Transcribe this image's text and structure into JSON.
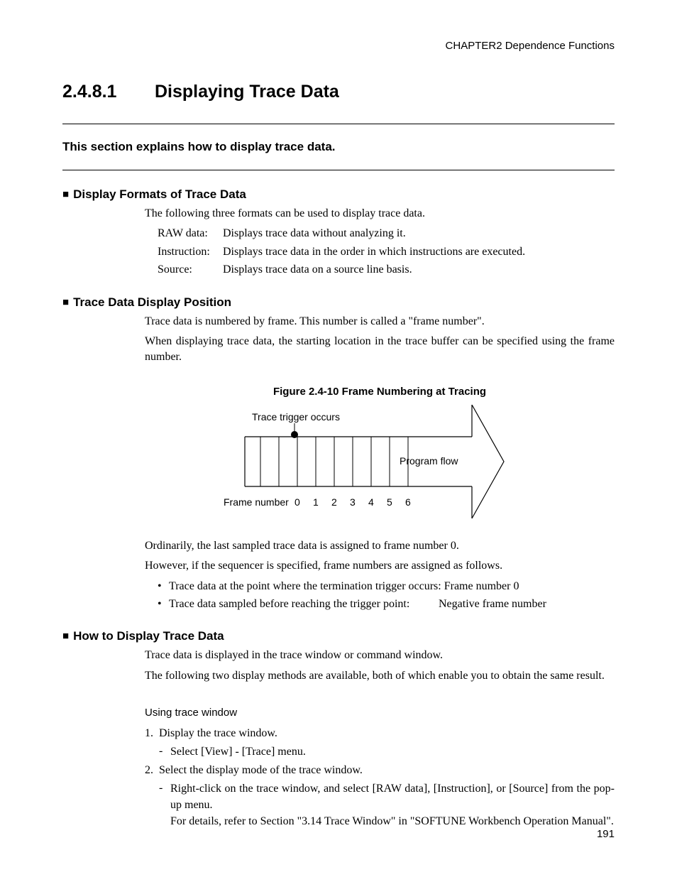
{
  "chapter_header": "CHAPTER2  Dependence Functions",
  "section_number": "2.4.8.1",
  "section_title": "Displaying Trace Data",
  "intro": "This section explains how to display trace data.",
  "s1": {
    "heading": "Display Formats of Trace Data",
    "lead": "The following three formats can be used to display trace data.",
    "defs": [
      {
        "label": "RAW data:",
        "desc": "Displays trace data without analyzing it."
      },
      {
        "label": "Instruction:",
        "desc": "Displays trace data in the order in which instructions are executed."
      },
      {
        "label": "Source:",
        "desc": "Displays trace data on a source line basis."
      }
    ]
  },
  "s2": {
    "heading": "Trace Data Display Position",
    "p1": "Trace data is numbered by frame. This number is called a \"frame number\".",
    "p2": "When displaying trace data, the starting location in the trace buffer can be specified using the frame number.",
    "figure_caption": "Figure 2.4-10  Frame Numbering at Tracing",
    "figure": {
      "trigger_label": "Trace trigger occurs",
      "flow_label": "Program flow",
      "frame_label": "Frame number",
      "ticks": [
        "0",
        "1",
        "2",
        "3",
        "4",
        "5",
        "6"
      ]
    },
    "p3": "Ordinarily, the last sampled trace data is assigned to frame number 0.",
    "p4": "However, if the sequencer is specified, frame numbers are assigned as follows.",
    "bullets": [
      {
        "left": "Trace data at the point where the termination trigger occurs: Frame number 0",
        "right": ""
      },
      {
        "left": "Trace data sampled before reaching the trigger point:",
        "right": "Negative frame number"
      }
    ]
  },
  "s3": {
    "heading": "How to Display Trace Data",
    "p1": "Trace data is displayed in the trace window or command window.",
    "p2": "The following two display methods are available, both of which enable you to obtain the same result.",
    "sub_heading": "Using trace window",
    "steps": [
      {
        "num": "1.",
        "text": "Display the trace window.",
        "dashes": [
          "Select [View] - [Trace] menu."
        ]
      },
      {
        "num": "2.",
        "text": "Select the display mode of the trace window.",
        "dashes": [
          "Right-click on the trace window, and select [RAW data], [Instruction], or [Source] from the pop-up menu.\nFor details, refer to Section \"3.14 Trace Window\" in \"SOFTUNE Workbench Operation Manual\"."
        ]
      }
    ]
  },
  "page_number": "191"
}
